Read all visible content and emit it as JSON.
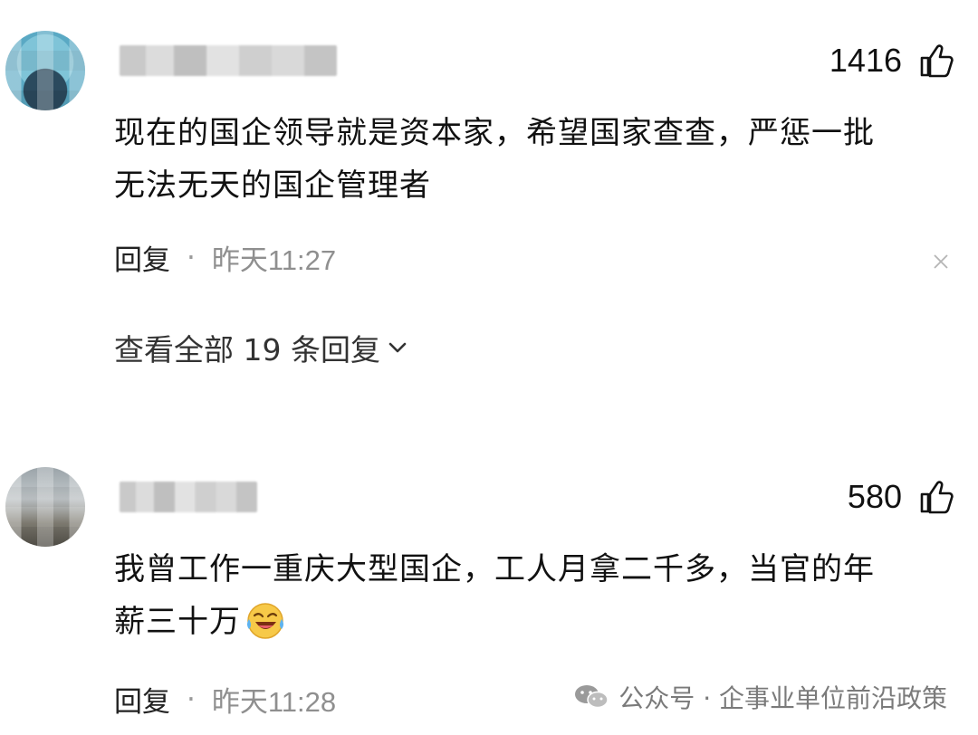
{
  "comments": [
    {
      "likes": "1416",
      "text_line1": "现在的国企领导就是资本家，希望国家查查，严惩一批",
      "text_line2": "无法无天的国企管理者",
      "reply_label": "回复",
      "separator": "·",
      "time": "昨天11:27",
      "view_all": "查看全部 19 条回复"
    },
    {
      "likes": "580",
      "text_line1": "我曾工作一重庆大型国企，工人月拿二千多，当官的年",
      "text_line2": "薪三十万",
      "reply_label": "回复",
      "separator": "·",
      "time": "昨天11:28"
    }
  ],
  "watermark": {
    "text": "公众号 · 企事业单位前沿政策"
  },
  "icons": {
    "like": "thumbs-up-icon",
    "close": "close-icon",
    "expand": "chevron-down-icon",
    "emoji": "laughing-crying-emoji",
    "watermark": "wechat-icon"
  }
}
